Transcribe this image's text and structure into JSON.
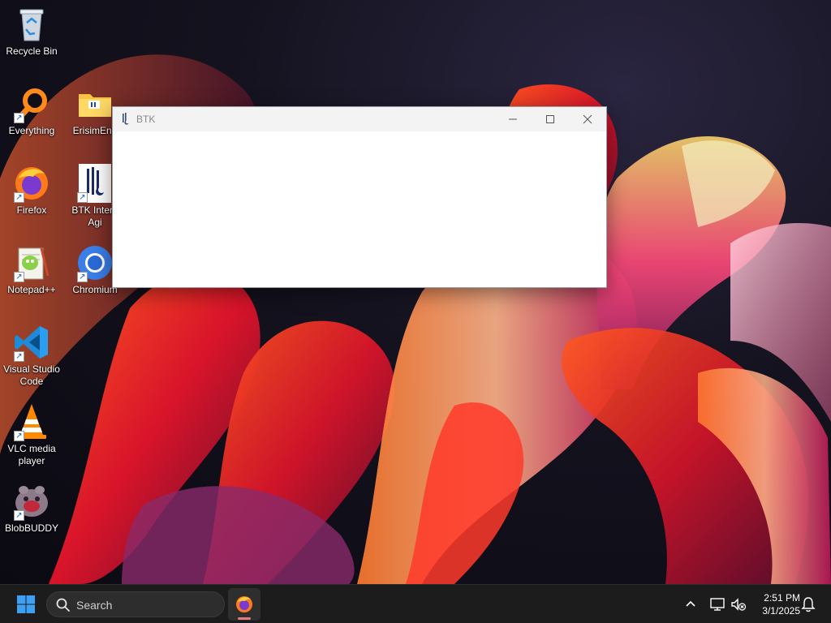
{
  "desktop": {
    "icons": [
      {
        "label": "Recycle Bin",
        "icon": "recycle-bin-icon"
      },
      {
        "label": "Everything",
        "icon": "everything-search-icon"
      },
      {
        "label": "ErisimEng",
        "icon": "folder-icon"
      },
      {
        "label": "Firefox",
        "icon": "firefox-icon"
      },
      {
        "label": "BTK Intern Agi",
        "icon": "btk-icon"
      },
      {
        "label": "Notepad++",
        "icon": "notepad-plus-plus-icon"
      },
      {
        "label": "Chromium",
        "icon": "chromium-icon"
      },
      {
        "label": "Visual Studio Code",
        "icon": "vscode-icon"
      },
      {
        "label": "VLC media player",
        "icon": "vlc-icon"
      },
      {
        "label": "BlobBUDDY",
        "icon": "blobbuddy-icon"
      }
    ]
  },
  "window": {
    "title": "BTK",
    "icon": "btk-app-icon",
    "controls": [
      "minimize-icon",
      "maximize-icon",
      "close-icon"
    ]
  },
  "taskbar": {
    "search_label": "Search",
    "pinned": [
      {
        "name": "Firefox",
        "icon": "firefox-icon",
        "running": true
      }
    ],
    "tray_icons": [
      "chevron-up-icon",
      "network-icon",
      "volume-muted-icon",
      "bell-icon"
    ],
    "time": "2:51 PM",
    "date": "3/1/2025"
  },
  "colors": {
    "taskbar_bg": "#1c1c1c",
    "titlebar_bg": "#f3f3f3",
    "window_bg": "#ffffff",
    "start_blue": "#3ea0f2"
  }
}
